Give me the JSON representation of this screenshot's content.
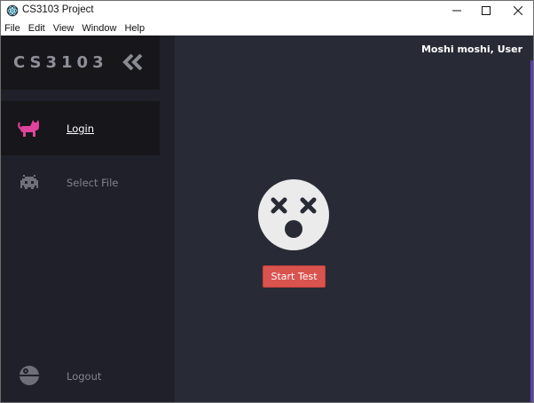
{
  "window": {
    "title": "CS3103 Project",
    "icon": "electron-icon",
    "controls": [
      "minimize-icon",
      "maximize-icon",
      "close-icon"
    ]
  },
  "menubar": {
    "items": [
      "File",
      "Edit",
      "View",
      "Window",
      "Help"
    ]
  },
  "sidebar": {
    "brand": "CS3103",
    "collapse_icon": "double-chevron-left-icon",
    "items": [
      {
        "label": "Login",
        "icon": "cat-icon",
        "active": true,
        "icon_color": "#e0439b"
      },
      {
        "label": "Select File",
        "icon": "space-invader-icon",
        "active": false,
        "icon_color": "#6f6f78"
      },
      {
        "label": "Logout",
        "icon": "death-star-icon",
        "active": false,
        "icon_color": "#6f6f78"
      }
    ]
  },
  "main": {
    "greeting": "Moshi moshi, User",
    "status_icon": "dizzy-face-icon",
    "start_button": "Start Test"
  },
  "colors": {
    "app_background": "#282b36",
    "sidebar_background": "#1f2029",
    "active_item_background": "#16161b",
    "start_button": "#d9534f",
    "accent": "#5d3fb0",
    "face": "#ebebeb"
  }
}
